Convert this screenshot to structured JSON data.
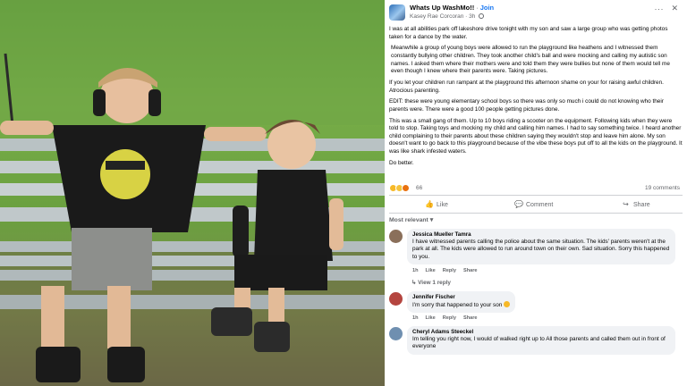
{
  "post": {
    "group_name": "Whats Up WashMo!!",
    "separator": "·",
    "join_label": "Join",
    "author": "Kasey Rae Corcoran",
    "time": "3h",
    "more_icon": "more-dots-icon",
    "close_icon": "close-icon",
    "paragraphs": [
      "I was at all abilities park off lakeshore drive tonight with my son and saw a large group who was getting photos taken for a dance by the water.",
      " Meanwhile a group of young boys were allowed to run the playground like heathens and I witnessed them constantly bullying other children. They took another child's ball and were mocking and calling my autistic son names. I asked them where their mothers were and told them they were bullies but none of them would tell me even though I knew where their parents were. Taking pictures.",
      "If you let your children run rampant at the playground this afternoon shame on your for raising awful children. Atrocious parenting.",
      "EDIT:  these were young elementary school boys so there was only so much i could do not knowing who their parents were. There were a good 100 people getting pictures done.",
      "This was a small gang of them. Up to 10 boys riding a scooter on the equipment. Following kids when they were told to stop. Taking toys and mocking my child and calling him names. I had to say something twice. I heard another child complaining to their parents about these children saying they wouldn't stop and leave him alone. My son doesn't want to go back to this playground because of the vibe these boys put off to all the kids on the playground. It was like shark infested waters.",
      "Do better."
    ],
    "reaction_count": "66",
    "comment_count": "19 comments",
    "actions": {
      "like": "Like",
      "comment": "Comment",
      "share": "Share"
    },
    "sort_label": "Most relevant"
  },
  "comments": [
    {
      "name": "Jessica Mueller Tamra",
      "text": "I have witnessed parents calling the police about the same situation. The kids' parents weren't at the park at all. The kids were allowed to run around town on their own. Sad situation. Sorry this happened to you.",
      "time": "1h",
      "like": "Like",
      "reply": "Reply",
      "share": "Share",
      "view_reply": "View 1 reply",
      "avatar_color": "#8a6f5a"
    },
    {
      "name": "Jennifer Fischer",
      "text": "I'm sorry that happened to your son",
      "time": "1h",
      "like": "Like",
      "reply": "Reply",
      "share": "Share",
      "avatar_color": "#b4453f"
    },
    {
      "name": "Cheryl Adams Steeckel",
      "text": "Im telling you right now, I would of walked right up to All those parents and called them out in front of everyone",
      "avatar_color": "#6f8fb0"
    }
  ],
  "colors": {
    "link_blue": "#1877f2",
    "secondary_text": "#65676b",
    "bubble_bg": "#f0f2f5"
  }
}
